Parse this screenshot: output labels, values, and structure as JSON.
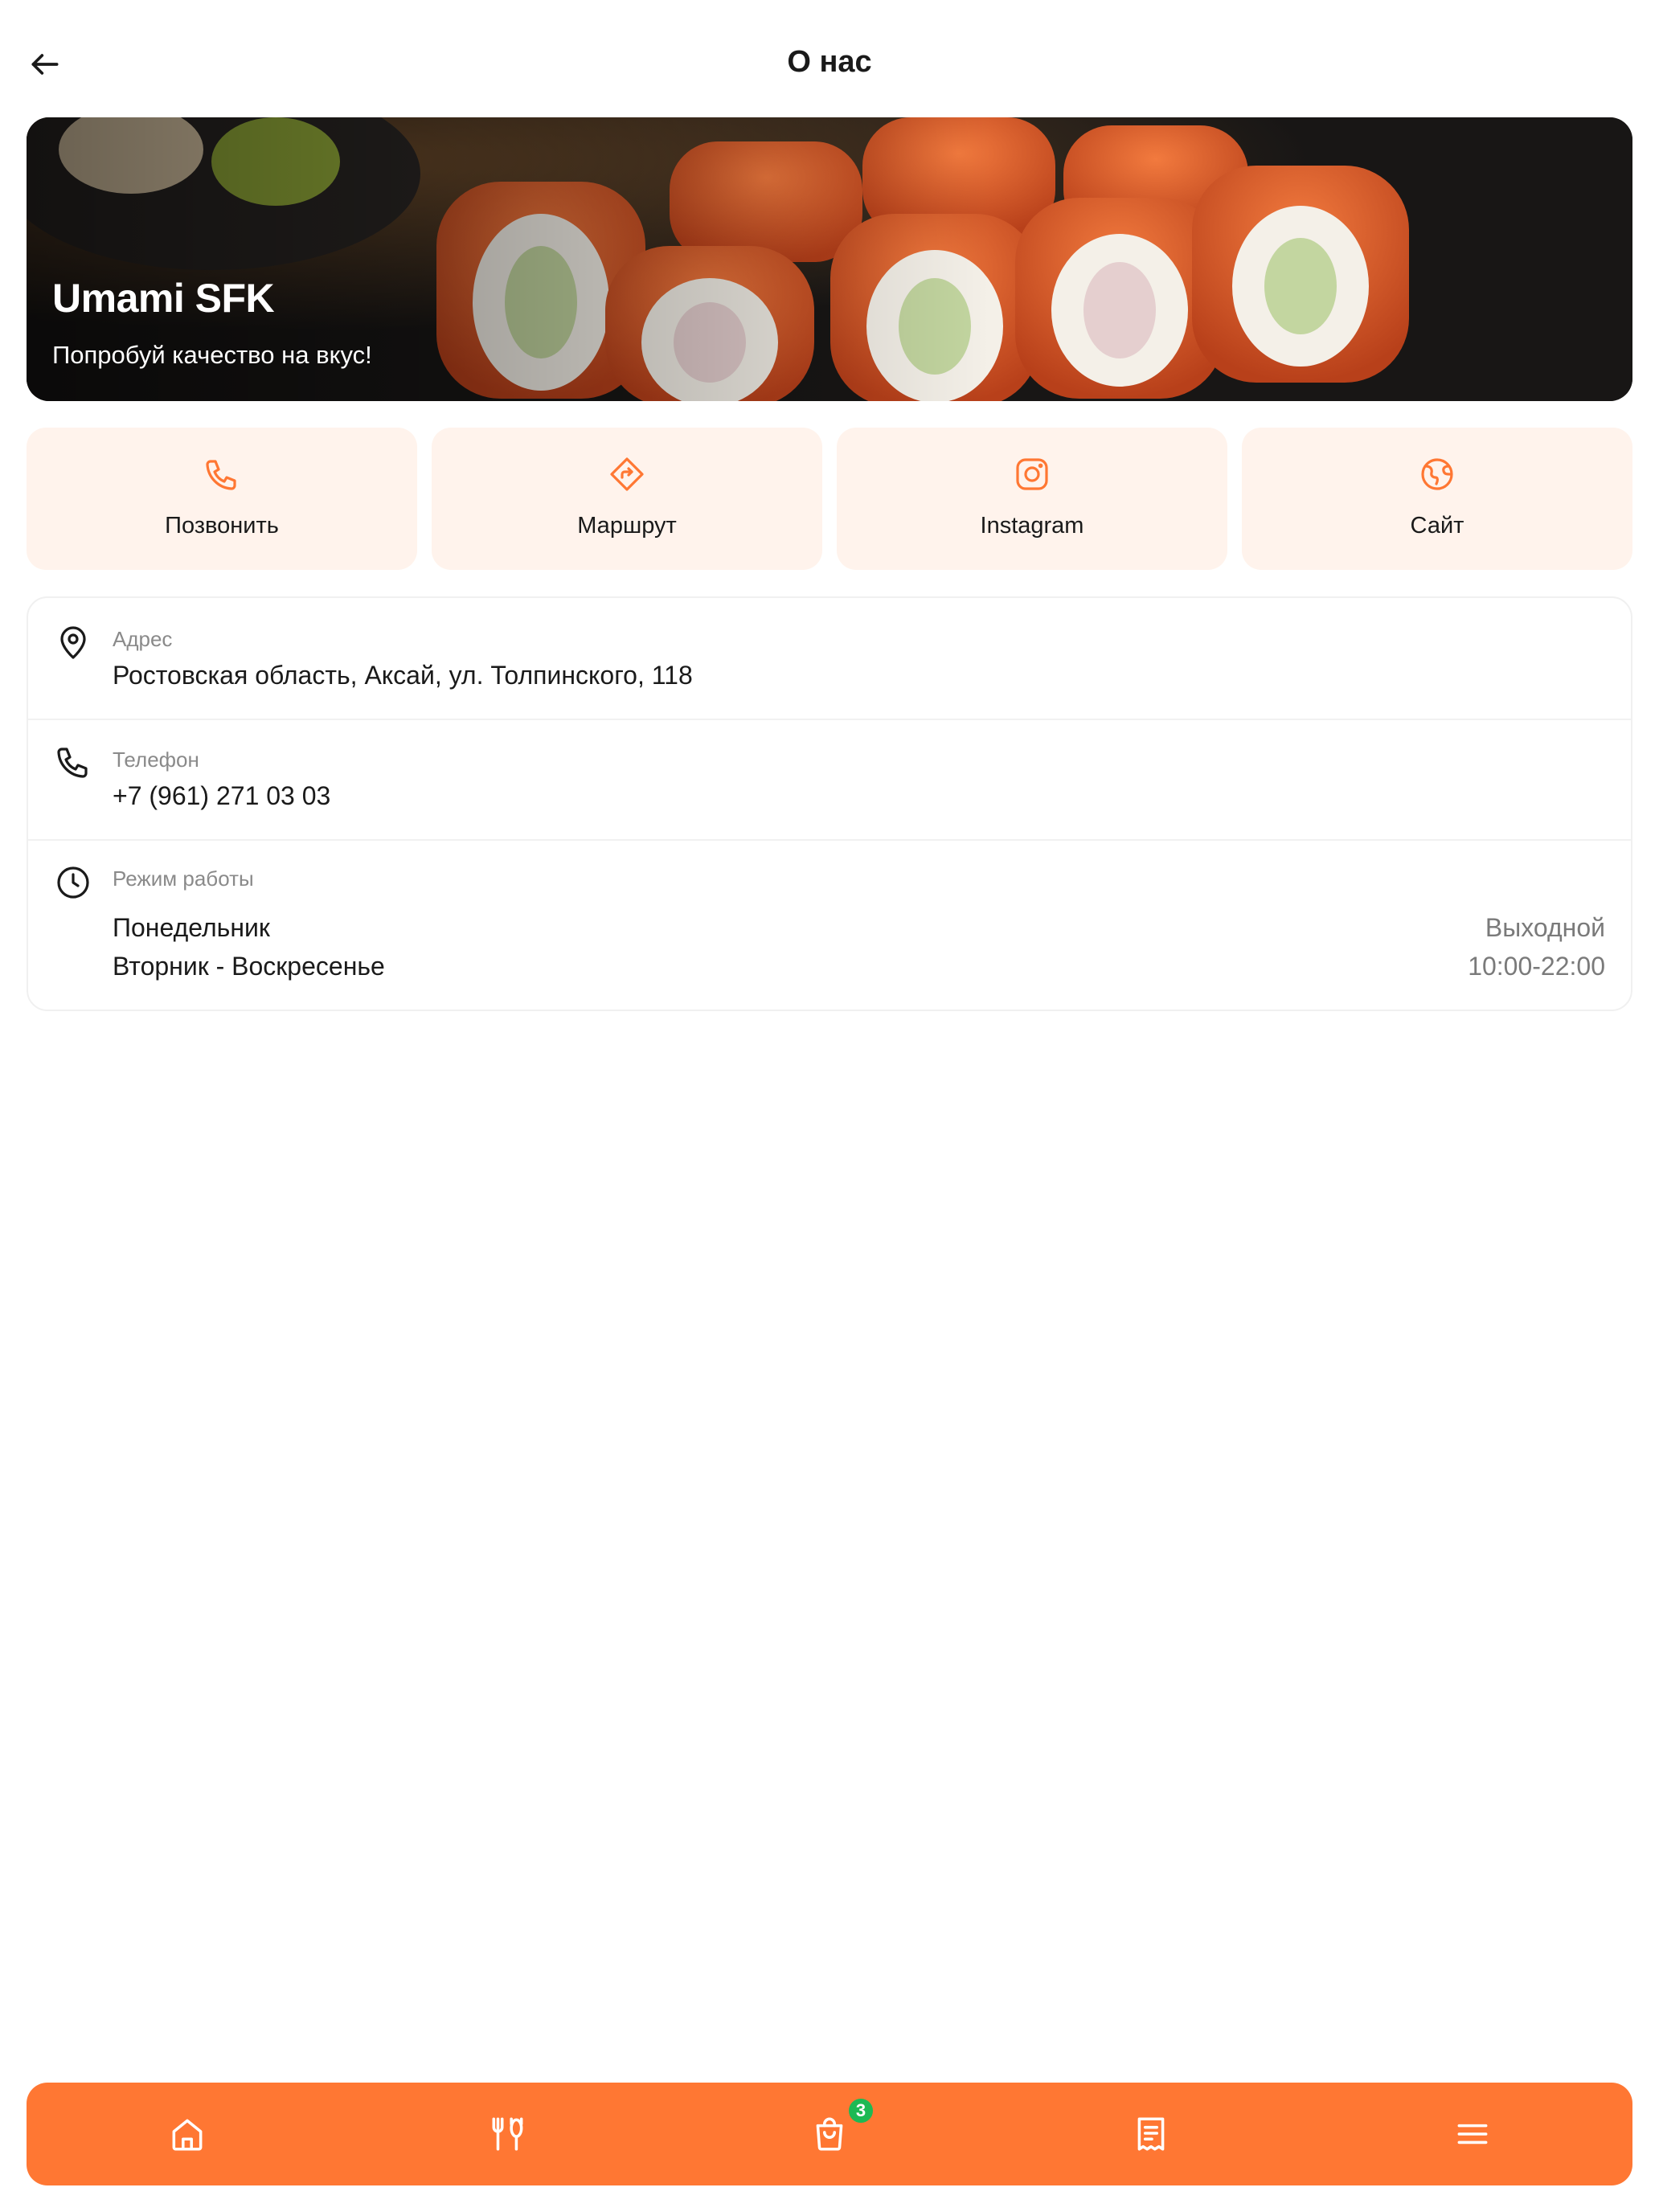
{
  "header": {
    "title": "О нас"
  },
  "hero": {
    "name": "Umami SFK",
    "tagline": "Попробуй качество на вкус!"
  },
  "actions": [
    {
      "label": "Позвонить",
      "icon": "phone-icon"
    },
    {
      "label": "Маршрут",
      "icon": "route-icon"
    },
    {
      "label": "Instagram",
      "icon": "instagram-icon"
    },
    {
      "label": "Сайт",
      "icon": "globe-icon"
    }
  ],
  "info": {
    "address": {
      "label": "Адрес",
      "value": "Ростовская область, Аксай, ул. Толпинского, 118"
    },
    "phone": {
      "label": "Телефон",
      "value": "+7 (961) 271 03 03"
    },
    "hours": {
      "label": "Режим работы",
      "rows": [
        {
          "day": "Понедельник",
          "time": "Выходной"
        },
        {
          "day": "Вторник - Воскресенье",
          "time": "10:00-22:00"
        }
      ]
    }
  },
  "bottom_nav": {
    "items": [
      "home-icon",
      "menu-cutlery-icon",
      "cart-icon",
      "receipt-icon",
      "hamburger-menu-icon"
    ],
    "cart_count": "3"
  },
  "colors": {
    "accent": "#ff7733",
    "action_bg": "#fff3ec",
    "badge": "#1db954"
  }
}
